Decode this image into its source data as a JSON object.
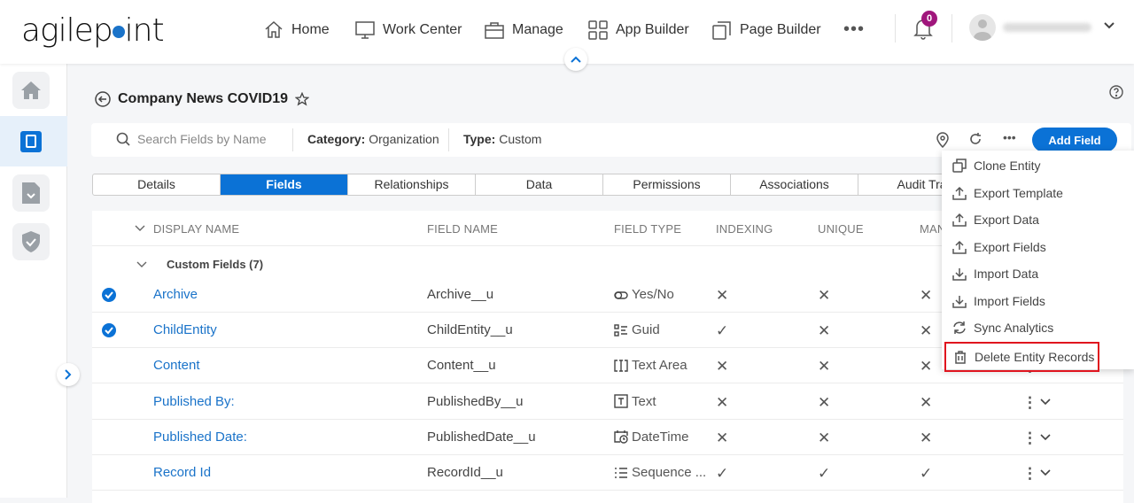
{
  "header": {
    "logo": "agilepoint",
    "nav": [
      {
        "label": "Home",
        "icon": "home-icon"
      },
      {
        "label": "Work Center",
        "icon": "monitor-icon"
      },
      {
        "label": "Manage",
        "icon": "briefcase-icon"
      },
      {
        "label": "App Builder",
        "icon": "grid-icon"
      },
      {
        "label": "Page Builder",
        "icon": "pages-icon"
      }
    ],
    "more": "•••",
    "notifications": "0"
  },
  "page": {
    "title": "Company News COVID19"
  },
  "toolbar": {
    "search_placeholder": "Search Fields by Name",
    "category_label": "Category:",
    "category_value": "Organization",
    "type_label": "Type:",
    "type_value": "Custom",
    "add_field": "Add Field"
  },
  "tabs": [
    {
      "label": "Details"
    },
    {
      "label": "Fields",
      "active": true
    },
    {
      "label": "Relationships"
    },
    {
      "label": "Data"
    },
    {
      "label": "Permissions"
    },
    {
      "label": "Associations"
    },
    {
      "label": "Audit Tra"
    }
  ],
  "table": {
    "headers": [
      "DISPLAY NAME",
      "FIELD NAME",
      "FIELD TYPE",
      "INDEXING",
      "UNIQUE",
      "MAN"
    ],
    "group": "Custom Fields (7)",
    "rows": [
      {
        "checked": true,
        "display": "Archive",
        "field": "Archive__u",
        "type": "Yes/No",
        "indexing": false,
        "unique": false,
        "mandatory": false
      },
      {
        "checked": true,
        "display": "ChildEntity",
        "field": "ChildEntity__u",
        "type": "Guid",
        "indexing": true,
        "unique": false,
        "mandatory": false
      },
      {
        "checked": false,
        "display": "Content",
        "field": "Content__u",
        "type": "Text Area",
        "indexing": false,
        "unique": false,
        "mandatory": false
      },
      {
        "checked": false,
        "display": "Published By:",
        "field": "PublishedBy__u",
        "type": "Text",
        "indexing": false,
        "unique": false,
        "mandatory": false
      },
      {
        "checked": false,
        "display": "Published Date:",
        "field": "PublishedDate__u",
        "type": "DateTime",
        "indexing": false,
        "unique": false,
        "mandatory": false
      },
      {
        "checked": false,
        "display": "Record Id",
        "field": "RecordId__u",
        "type": "Sequence ...",
        "indexing": true,
        "unique": true,
        "mandatory": true
      }
    ]
  },
  "menu": [
    {
      "label": "Clone Entity",
      "icon": "clone-icon"
    },
    {
      "label": "Export Template",
      "icon": "upload-icon"
    },
    {
      "label": "Export Data",
      "icon": "upload-icon"
    },
    {
      "label": "Export Fields",
      "icon": "upload-icon"
    },
    {
      "label": "Import Data",
      "icon": "download-icon"
    },
    {
      "label": "Import Fields",
      "icon": "download-icon"
    },
    {
      "label": "Sync Analytics",
      "icon": "sync-icon"
    },
    {
      "label": "Delete Entity Records",
      "icon": "trash-icon",
      "highlighted": true
    }
  ],
  "colors": {
    "accent": "#0b72d6",
    "badge": "#a0167c",
    "highlight": "#e0141e"
  }
}
